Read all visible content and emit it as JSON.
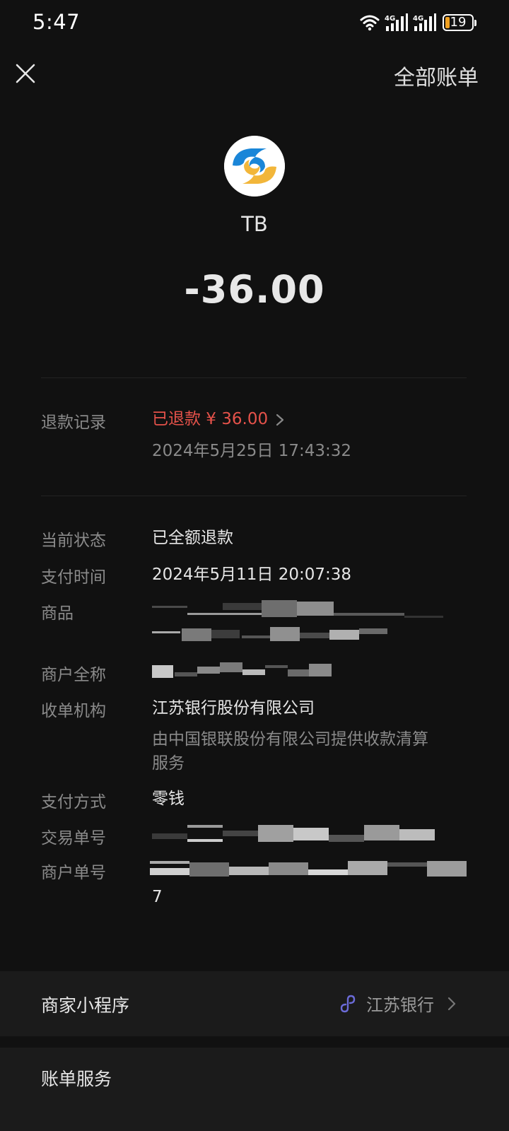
{
  "status_bar": {
    "time": "5:47",
    "network_1": "4G",
    "network_2": "4G",
    "battery_level": "19",
    "icons": [
      "wifi-icon",
      "signal-icon",
      "signal-icon",
      "battery-icon"
    ]
  },
  "nav": {
    "close_icon": "close-icon",
    "all_bills_label": "全部账单"
  },
  "header": {
    "merchant_name": "TB",
    "amount": "-36.00",
    "logo_icon": "jiangsu-bank-logo"
  },
  "refund": {
    "label": "退款记录",
    "status": "已退款 ¥ 36.00",
    "time": "2024年5月25日 17:43:32"
  },
  "details": {
    "status_label": "当前状态",
    "status_value": "已全额退款",
    "pay_time_label": "支付时间",
    "pay_time_value": "2024年5月11日 20:07:38",
    "product_label": "商品",
    "merchant_full_label": "商户全称",
    "acquirer_label": "收单机构",
    "acquirer_value": "江苏银行股份有限公司",
    "acquirer_sub_line1": "由中国银联股份有限公司提供收款清算",
    "acquirer_sub_line2": "服务",
    "pay_method_label": "支付方式",
    "pay_method_value": "零钱",
    "txn_no_label": "交易单号",
    "merchant_no_label": "商户单号",
    "merchant_no_tail": "7"
  },
  "mini_program": {
    "label": "商家小程序",
    "value": "江苏银行"
  },
  "bill_service": {
    "label": "账单服务"
  },
  "colors": {
    "background": "#111111",
    "refund_red": "#e5524a",
    "label_gray": "#8a8a8a",
    "mini_program_link": "#6b6bd8",
    "logo_blue": "#1a86d8",
    "logo_yellow": "#f2b63a"
  }
}
